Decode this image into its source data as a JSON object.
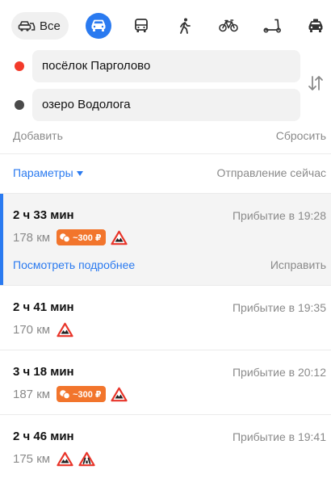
{
  "modes": {
    "all_label": "Все",
    "items": [
      {
        "name": "car-icon",
        "active": true
      },
      {
        "name": "bus-icon",
        "active": false
      },
      {
        "name": "pedestrian-icon",
        "active": false
      },
      {
        "name": "bicycle-icon",
        "active": false
      },
      {
        "name": "scooter-icon",
        "active": false
      },
      {
        "name": "taxi-icon",
        "active": false
      }
    ]
  },
  "route_points": {
    "from": "посёлок Парголово",
    "to": "озеро Водолога"
  },
  "actions": {
    "add": "Добавить",
    "reset": "Сбросить"
  },
  "options": {
    "params": "Параметры",
    "departure": "Отправление сейчас"
  },
  "routes": [
    {
      "duration": "2 ч 33 мин",
      "arrival": "Прибытие в 19:28",
      "distance": "178 км",
      "toll": "~300 ₽",
      "warnings": 1,
      "details": "Посмотреть подробнее",
      "edit": "Исправить",
      "selected": true
    },
    {
      "duration": "2 ч 41 мин",
      "arrival": "Прибытие в 19:35",
      "distance": "170 км",
      "toll": "",
      "warnings": 1,
      "selected": false
    },
    {
      "duration": "3 ч 18 мин",
      "arrival": "Прибытие в 20:12",
      "distance": "187 км",
      "toll": "~300 ₽",
      "warnings": 1,
      "selected": false
    },
    {
      "duration": "2 ч 46 мин",
      "arrival": "Прибытие в 19:41",
      "distance": "175 км",
      "toll": "",
      "warnings": 2,
      "selected": false
    }
  ],
  "colors": {
    "accent": "#2a7af0",
    "start_point": "#f33a2a",
    "end_point": "#4a4a4a",
    "toll_badge": "#f2752c",
    "warning": "#e8352a"
  }
}
